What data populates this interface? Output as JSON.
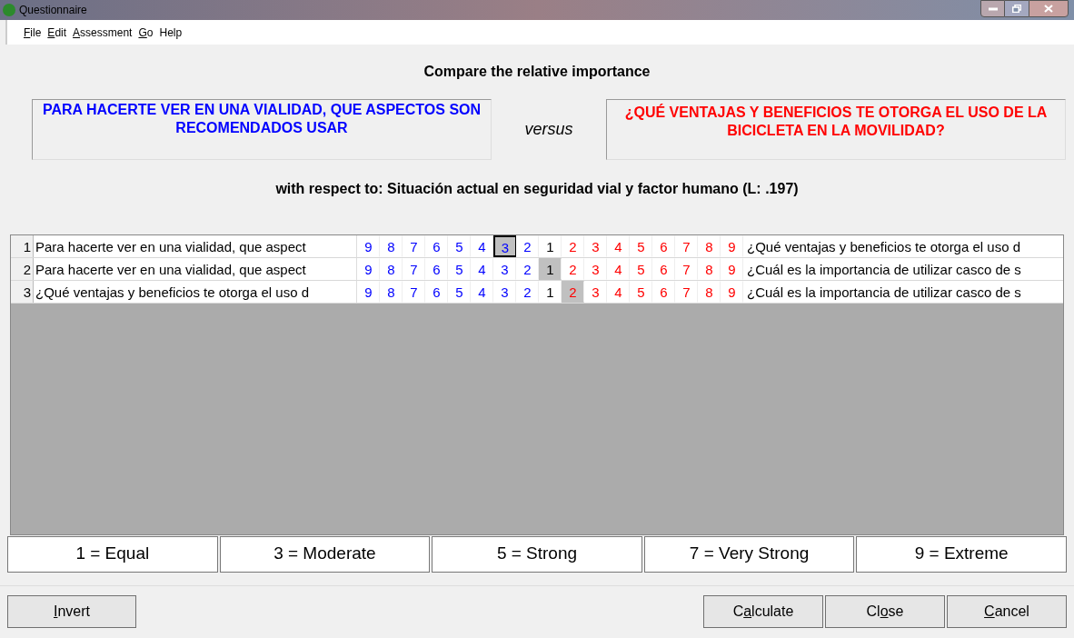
{
  "window": {
    "title": "Questionnaire"
  },
  "menu": [
    "**F**ile",
    "**E**dit",
    "**A**ssessment",
    "**G**o",
    "Help"
  ],
  "heading": "Compare the relative importance",
  "left_element": "PARA HACERTE VER EN UNA VIALIDAD, QUE ASPECTOS SON RECOMENDADOS USAR",
  "versus": "versus",
  "right_element": "¿QUÉ VENTAJAS Y BENEFICIOS TE OTORGA EL USO DE LA BICICLETA EN LA MOVILIDAD?",
  "with_respect_to": "with respect to: Situación actual en seguridad vial y factor humano (L: .197)",
  "rows": [
    {
      "number": "1",
      "left": "Para hacerte ver en una vialidad, que aspect",
      "right": "¿Qué ventajas y beneficios te otorga el uso d",
      "focused": true,
      "cells": [
        {
          "label": "9",
          "kind": "left",
          "selected": false
        },
        {
          "label": "8",
          "kind": "left",
          "selected": false
        },
        {
          "label": "7",
          "kind": "left",
          "selected": false
        },
        {
          "label": "6",
          "kind": "left",
          "selected": false
        },
        {
          "label": "5",
          "kind": "left",
          "selected": false
        },
        {
          "label": "4",
          "kind": "left",
          "selected": false
        },
        {
          "label": "3",
          "kind": "left",
          "selected": true
        },
        {
          "label": "2",
          "kind": "left",
          "selected": false
        },
        {
          "label": "1",
          "kind": "equal",
          "selected": false
        },
        {
          "label": "2",
          "kind": "right",
          "selected": false
        },
        {
          "label": "3",
          "kind": "right",
          "selected": false
        },
        {
          "label": "4",
          "kind": "right",
          "selected": false
        },
        {
          "label": "5",
          "kind": "right",
          "selected": false
        },
        {
          "label": "6",
          "kind": "right",
          "selected": false
        },
        {
          "label": "7",
          "kind": "right",
          "selected": false
        },
        {
          "label": "8",
          "kind": "right",
          "selected": false
        },
        {
          "label": "9",
          "kind": "right",
          "selected": false
        }
      ]
    },
    {
      "number": "2",
      "left": "Para hacerte ver en una vialidad, que aspect",
      "right": "¿Cuál es la importancia de utilizar casco de s",
      "focused": false,
      "cells": [
        {
          "label": "9",
          "kind": "left",
          "selected": false
        },
        {
          "label": "8",
          "kind": "left",
          "selected": false
        },
        {
          "label": "7",
          "kind": "left",
          "selected": false
        },
        {
          "label": "6",
          "kind": "left",
          "selected": false
        },
        {
          "label": "5",
          "kind": "left",
          "selected": false
        },
        {
          "label": "4",
          "kind": "left",
          "selected": false
        },
        {
          "label": "3",
          "kind": "left",
          "selected": false
        },
        {
          "label": "2",
          "kind": "left",
          "selected": false
        },
        {
          "label": "1",
          "kind": "equal",
          "selected": true
        },
        {
          "label": "2",
          "kind": "right",
          "selected": false
        },
        {
          "label": "3",
          "kind": "right",
          "selected": false
        },
        {
          "label": "4",
          "kind": "right",
          "selected": false
        },
        {
          "label": "5",
          "kind": "right",
          "selected": false
        },
        {
          "label": "6",
          "kind": "right",
          "selected": false
        },
        {
          "label": "7",
          "kind": "right",
          "selected": false
        },
        {
          "label": "8",
          "kind": "right",
          "selected": false
        },
        {
          "label": "9",
          "kind": "right",
          "selected": false
        }
      ]
    },
    {
      "number": "3",
      "left": "¿Qué ventajas y beneficios te otorga el uso d",
      "right": "¿Cuál es la importancia de utilizar casco de s",
      "focused": false,
      "cells": [
        {
          "label": "9",
          "kind": "left",
          "selected": false
        },
        {
          "label": "8",
          "kind": "left",
          "selected": false
        },
        {
          "label": "7",
          "kind": "left",
          "selected": false
        },
        {
          "label": "6",
          "kind": "left",
          "selected": false
        },
        {
          "label": "5",
          "kind": "left",
          "selected": false
        },
        {
          "label": "4",
          "kind": "left",
          "selected": false
        },
        {
          "label": "3",
          "kind": "left",
          "selected": false
        },
        {
          "label": "2",
          "kind": "left",
          "selected": false
        },
        {
          "label": "1",
          "kind": "equal",
          "selected": false
        },
        {
          "label": "2",
          "kind": "right",
          "selected": true
        },
        {
          "label": "3",
          "kind": "right",
          "selected": false
        },
        {
          "label": "4",
          "kind": "right",
          "selected": false
        },
        {
          "label": "5",
          "kind": "right",
          "selected": false
        },
        {
          "label": "6",
          "kind": "right",
          "selected": false
        },
        {
          "label": "7",
          "kind": "right",
          "selected": false
        },
        {
          "label": "8",
          "kind": "right",
          "selected": false
        },
        {
          "label": "9",
          "kind": "right",
          "selected": false
        }
      ]
    }
  ],
  "legend": [
    "1 = Equal",
    "3 = Moderate",
    "5 = Strong",
    "7 = Very Strong",
    "9 = Extreme"
  ],
  "left_buttons": [
    "**I**nvert"
  ],
  "right_buttons": [
    "C**a**lculate",
    "Cl**o**se",
    "**C**ancel"
  ]
}
